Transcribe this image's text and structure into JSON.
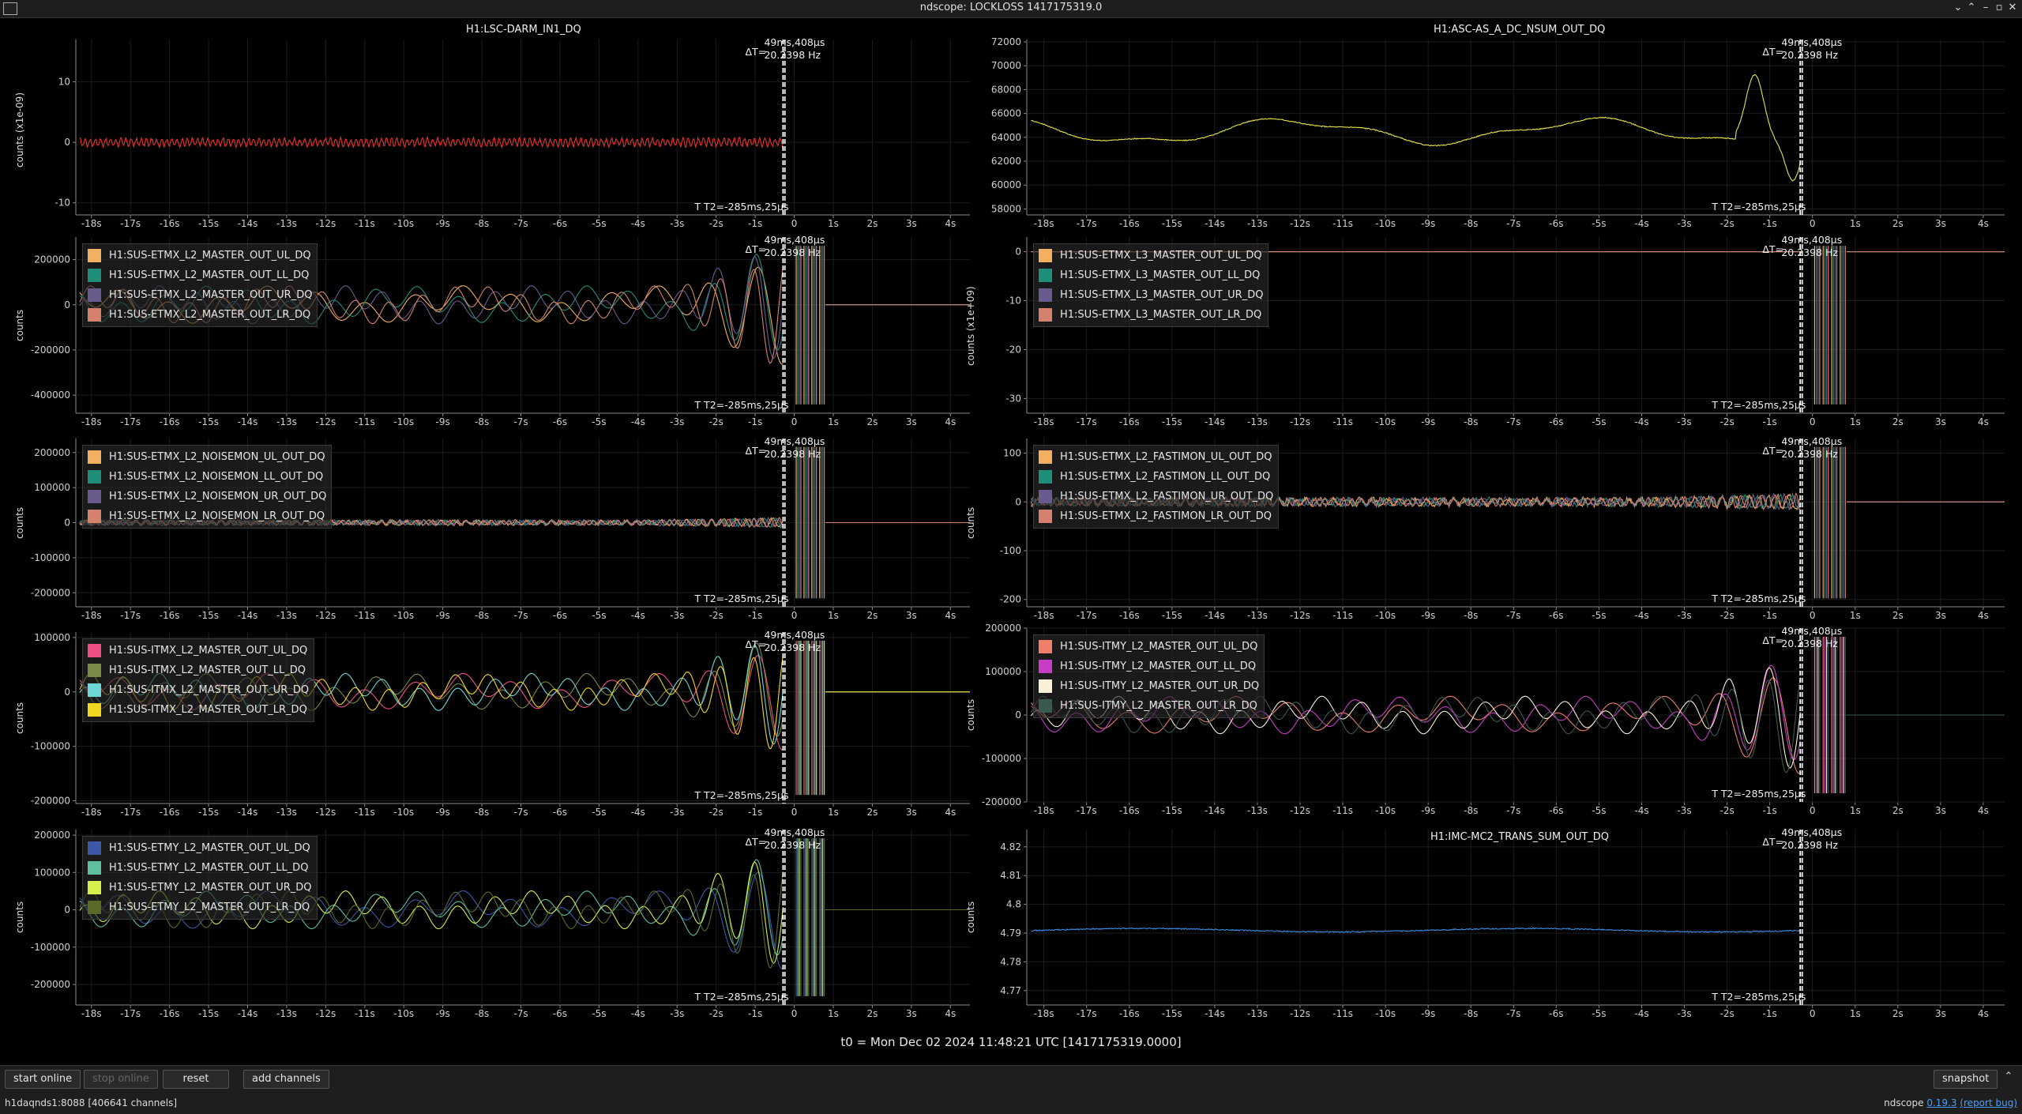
{
  "window": {
    "title": "ndscope: LOCKLOSS 1417175319.0"
  },
  "cursor": {
    "delta_t": "ΔT=",
    "t1": "49ms,408μs",
    "freq": "20.2398 Hz",
    "t2": "T T2=-285ms,25μs"
  },
  "x_ticks": [
    "-18s",
    "-17s",
    "-16s",
    "-15s",
    "-14s",
    "-13s",
    "-12s",
    "-11s",
    "-10s",
    "-9s",
    "-8s",
    "-7s",
    "-6s",
    "-5s",
    "-4s",
    "-3s",
    "-2s",
    "-1s",
    "0",
    "1s",
    "2s",
    "3s",
    "4s"
  ],
  "plots": [
    {
      "title": "H1:LSC-DARM_IN1_DQ",
      "ylabel": "counts (x1e-09)",
      "yticks": [
        "10",
        "0",
        "-10"
      ],
      "ylim": [
        -12,
        17
      ],
      "legend": [],
      "series": [
        {
          "color": "#e8322e",
          "style": "darm"
        }
      ]
    },
    {
      "title": "H1:ASC-AS_A_DC_NSUM_OUT_DQ",
      "ylabel": "",
      "yticks": [
        "72000",
        "70000",
        "68000",
        "66000",
        "64000",
        "62000",
        "60000",
        "58000"
      ],
      "ylim": [
        57500,
        72200
      ],
      "legend": [],
      "series": [
        {
          "color": "#e6e24a",
          "style": "asc"
        }
      ]
    },
    {
      "title": "",
      "ylabel": "counts",
      "yticks": [
        "200000",
        "0",
        "-200000",
        "-400000"
      ],
      "ylim": [
        -480000,
        300000
      ],
      "legend": [
        "H1:SUS-ETMX_L2_MASTER_OUT_UL_DQ",
        "H1:SUS-ETMX_L2_MASTER_OUT_LL_DQ",
        "H1:SUS-ETMX_L2_MASTER_OUT_UR_DQ",
        "H1:SUS-ETMX_L2_MASTER_OUT_LR_DQ"
      ],
      "series": [
        {
          "color": "#f2b060"
        },
        {
          "color": "#1f8f7a"
        },
        {
          "color": "#6a5b8e"
        },
        {
          "color": "#d4826e"
        }
      ]
    },
    {
      "title": "",
      "ylabel": "counts (x1e+09)",
      "yticks": [
        "0",
        "-10",
        "-20",
        "-30"
      ],
      "ylim": [
        -33,
        3
      ],
      "legend": [
        "H1:SUS-ETMX_L3_MASTER_OUT_UL_DQ",
        "H1:SUS-ETMX_L3_MASTER_OUT_LL_DQ",
        "H1:SUS-ETMX_L3_MASTER_OUT_UR_DQ",
        "H1:SUS-ETMX_L3_MASTER_OUT_LR_DQ"
      ],
      "series": [
        {
          "color": "#f2b060"
        },
        {
          "color": "#1f8f7a"
        },
        {
          "color": "#6a5b8e"
        },
        {
          "color": "#d4826e"
        }
      ]
    },
    {
      "title": "",
      "ylabel": "counts",
      "yticks": [
        "200000",
        "100000",
        "0",
        "-100000",
        "-200000"
      ],
      "ylim": [
        -240000,
        240000
      ],
      "legend": [
        "H1:SUS-ETMX_L2_NOISEMON_UL_OUT_DQ",
        "H1:SUS-ETMX_L2_NOISEMON_LL_OUT_DQ",
        "H1:SUS-ETMX_L2_NOISEMON_UR_OUT_DQ",
        "H1:SUS-ETMX_L2_NOISEMON_LR_OUT_DQ"
      ],
      "series": [
        {
          "color": "#f2b060"
        },
        {
          "color": "#1f8f7a"
        },
        {
          "color": "#6a5b8e"
        },
        {
          "color": "#d4826e"
        }
      ]
    },
    {
      "title": "",
      "ylabel": "counts",
      "yticks": [
        "100",
        "0",
        "-100",
        "-200"
      ],
      "ylim": [
        -215,
        130
      ],
      "legend": [
        "H1:SUS-ETMX_L2_FASTIMON_UL_OUT_DQ",
        "H1:SUS-ETMX_L2_FASTIMON_LL_OUT_DQ",
        "H1:SUS-ETMX_L2_FASTIMON_UR_OUT_DQ",
        "H1:SUS-ETMX_L2_FASTIMON_LR_OUT_DQ"
      ],
      "series": [
        {
          "color": "#f2b060"
        },
        {
          "color": "#1f8f7a"
        },
        {
          "color": "#6a5b8e"
        },
        {
          "color": "#d4826e"
        }
      ]
    },
    {
      "title": "",
      "ylabel": "counts",
      "yticks": [
        "100000",
        "0",
        "-100000",
        "-200000"
      ],
      "ylim": [
        -205000,
        110000
      ],
      "legend": [
        "H1:SUS-ITMX_L2_MASTER_OUT_UL_DQ",
        "H1:SUS-ITMX_L2_MASTER_OUT_LL_DQ",
        "H1:SUS-ITMX_L2_MASTER_OUT_UR_DQ",
        "H1:SUS-ITMX_L2_MASTER_OUT_LR_DQ"
      ],
      "series": [
        {
          "color": "#ec4f86"
        },
        {
          "color": "#7a8a48"
        },
        {
          "color": "#6fd6d6"
        },
        {
          "color": "#f0d820"
        }
      ]
    },
    {
      "title": "",
      "ylabel": "counts",
      "yticks": [
        "200000",
        "100000",
        "0",
        "-100000",
        "-200000"
      ],
      "ylim": [
        -200000,
        200000
      ],
      "legend": [
        "H1:SUS-ITMY_L2_MASTER_OUT_UL_DQ",
        "H1:SUS-ITMY_L2_MASTER_OUT_LL_DQ",
        "H1:SUS-ITMY_L2_MASTER_OUT_UR_DQ",
        "H1:SUS-ITMY_L2_MASTER_OUT_LR_DQ"
      ],
      "series": [
        {
          "color": "#f07e6a"
        },
        {
          "color": "#c83cc8"
        },
        {
          "color": "#f8f0d8"
        },
        {
          "color": "#3a5a50"
        }
      ]
    },
    {
      "title": "",
      "ylabel": "counts",
      "yticks": [
        "200000",
        "100000",
        "0",
        "-100000",
        "-200000"
      ],
      "ylim": [
        -255000,
        215000
      ],
      "legend": [
        "H1:SUS-ETMY_L2_MASTER_OUT_UL_DQ",
        "H1:SUS-ETMY_L2_MASTER_OUT_LL_DQ",
        "H1:SUS-ETMY_L2_MASTER_OUT_UR_DQ",
        "H1:SUS-ETMY_L2_MASTER_OUT_LR_DQ"
      ],
      "series": [
        {
          "color": "#3c58a6"
        },
        {
          "color": "#5ec0a0"
        },
        {
          "color": "#d4f04a"
        },
        {
          "color": "#5a6a28"
        }
      ]
    },
    {
      "title": "H1:IMC-MC2_TRANS_SUM_OUT_DQ",
      "ylabel": "counts",
      "yticks": [
        "4.82",
        "4.81",
        "4.8",
        "4.79",
        "4.78",
        "4.77"
      ],
      "ylim": [
        4.765,
        4.826
      ],
      "legend": [],
      "series": [
        {
          "color": "#3a8ee6"
        }
      ]
    }
  ],
  "footer": {
    "t0": "t0 = Mon Dec 02 2024 11:48:21 UTC [1417175319.0000]",
    "buttons": {
      "start_online": "start online",
      "stop_online": "stop online",
      "reset": "reset",
      "add_channels": "add channels",
      "snapshot": "snapshot"
    },
    "status": "h1daqnds1:8088  [406641 channels]",
    "version_prefix": "ndscope ",
    "version": "0.19.3",
    "report_bug": "(report bug)"
  }
}
